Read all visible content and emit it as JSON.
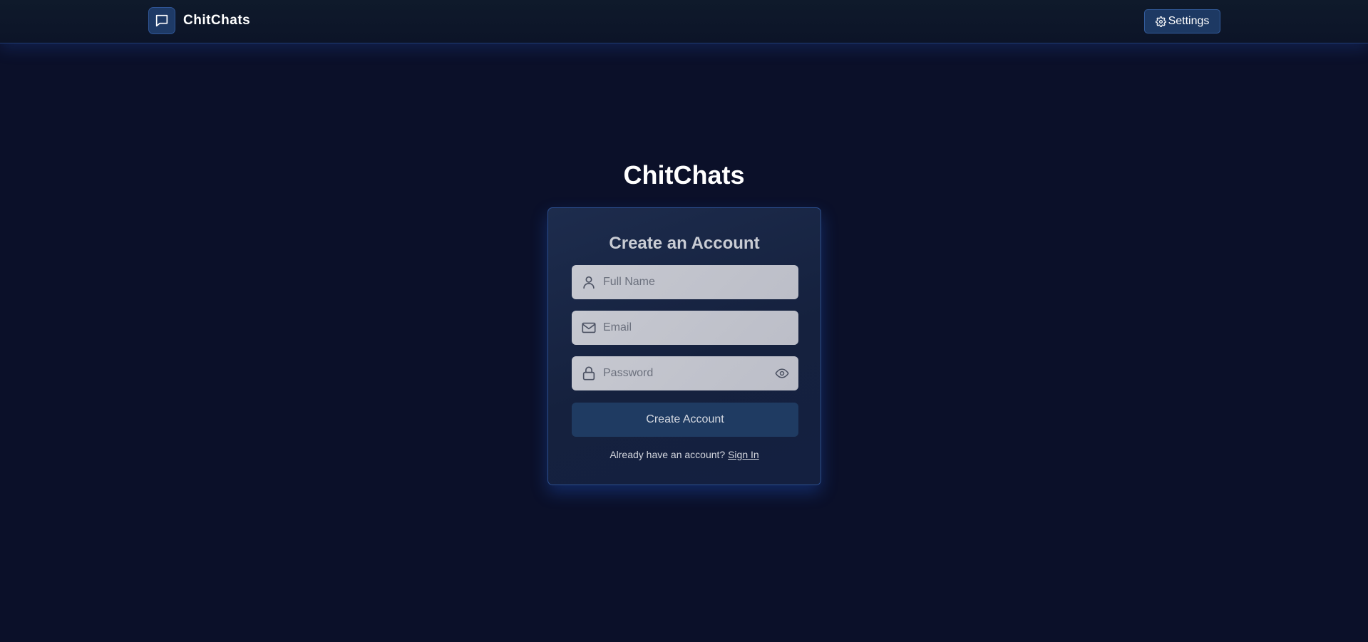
{
  "navbar": {
    "brand_icon": "chat-bubble-icon",
    "brand_name": "ChitChats",
    "settings_icon": "gear-icon",
    "settings_label": "Settings"
  },
  "page": {
    "title": "ChitChats"
  },
  "form": {
    "heading": "Create an Account",
    "full_name": {
      "icon": "user-icon",
      "placeholder": "Full Name",
      "value": ""
    },
    "email": {
      "icon": "mail-icon",
      "placeholder": "Email",
      "value": ""
    },
    "password": {
      "icon": "lock-icon",
      "placeholder": "Password",
      "value": "",
      "toggle_icon": "eye-icon"
    },
    "submit_label": "Create Account",
    "signin_prompt": "Already have an account?",
    "signin_link": "Sign In"
  },
  "colors": {
    "background": "#0b1029",
    "card_border": "#2c4f8f",
    "button": "#1f3b62",
    "field": "#c6c8d0"
  }
}
